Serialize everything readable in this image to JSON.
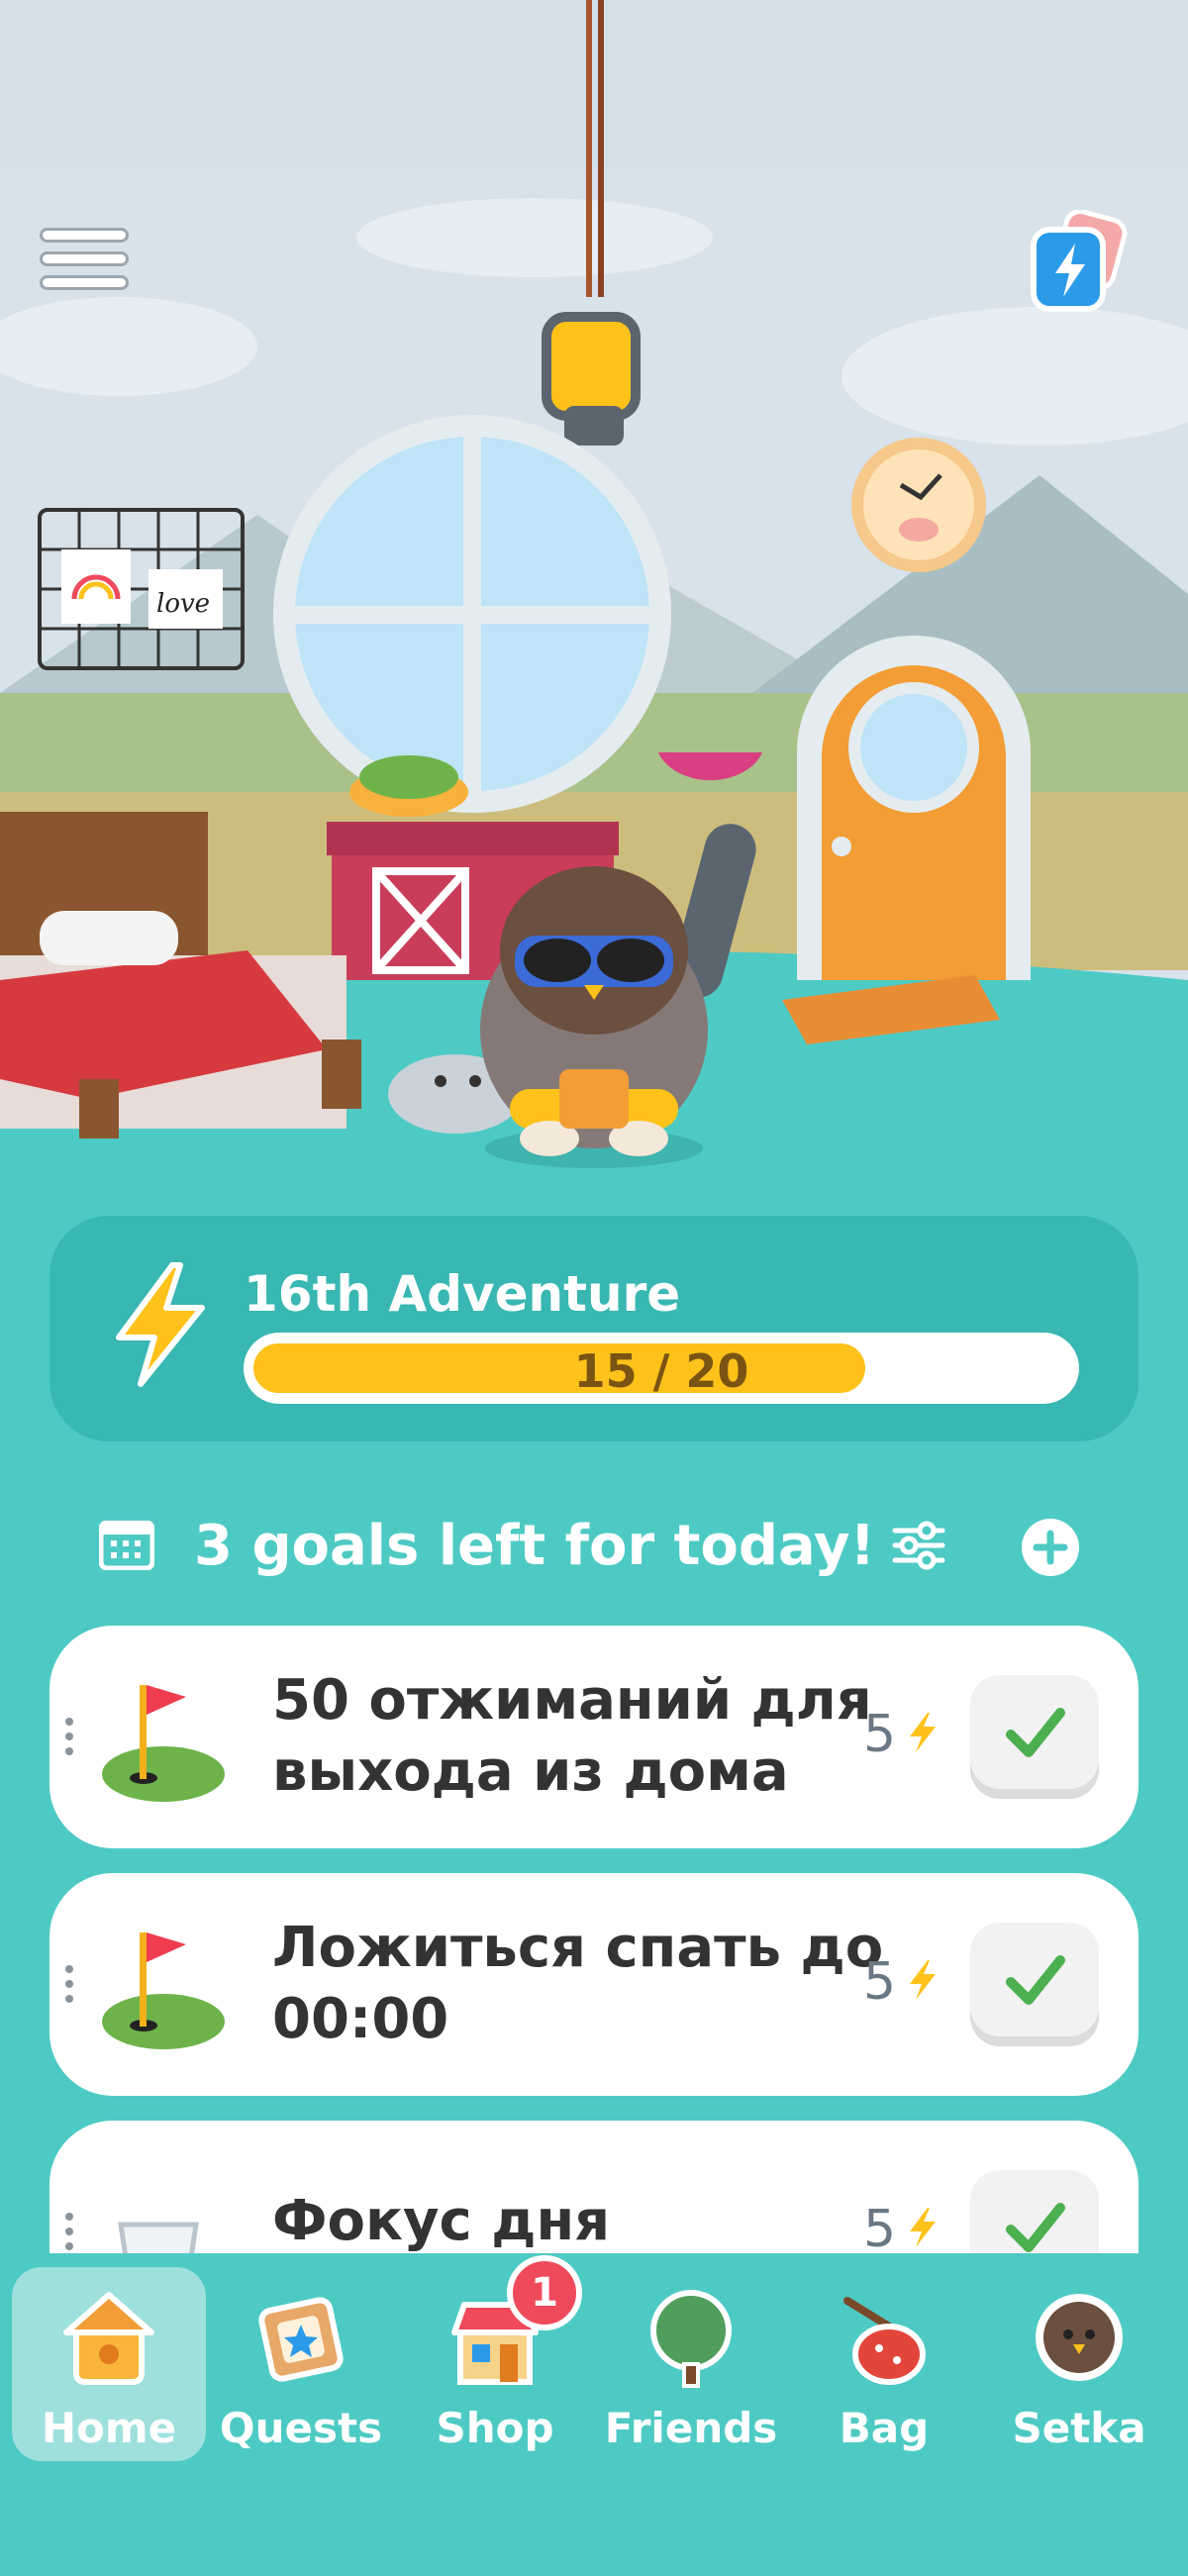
{
  "adventure": {
    "title": "16th Adventure",
    "progress_text": "15 / 20",
    "progress": 0.75
  },
  "goals_header": {
    "title": "3 goals left for today!"
  },
  "goals": [
    {
      "text": "50 отжиманий для выхода из дома",
      "points": "5",
      "icon": "flag-icon"
    },
    {
      "text": "Ложиться спать до 00:00",
      "points": "5",
      "icon": "flag-icon"
    },
    {
      "text": "Фокус дня",
      "points": "5",
      "icon": "water-glass-icon"
    }
  ],
  "scene": {
    "picture_text": "love"
  },
  "tabs": [
    {
      "label": "Home",
      "icon": "house-icon",
      "active": true
    },
    {
      "label": "Quests",
      "icon": "quests-icon"
    },
    {
      "label": "Shop",
      "icon": "shop-icon",
      "badge": "1"
    },
    {
      "label": "Friends",
      "icon": "tree-icon"
    },
    {
      "label": "Bag",
      "icon": "bag-icon"
    },
    {
      "label": "Setka",
      "icon": "bird-avatar-icon"
    }
  ],
  "colors": {
    "teal": "#4ecac4",
    "energy": "#ffc21a",
    "check": "#4caf50",
    "badge": "#ef4a5c"
  }
}
